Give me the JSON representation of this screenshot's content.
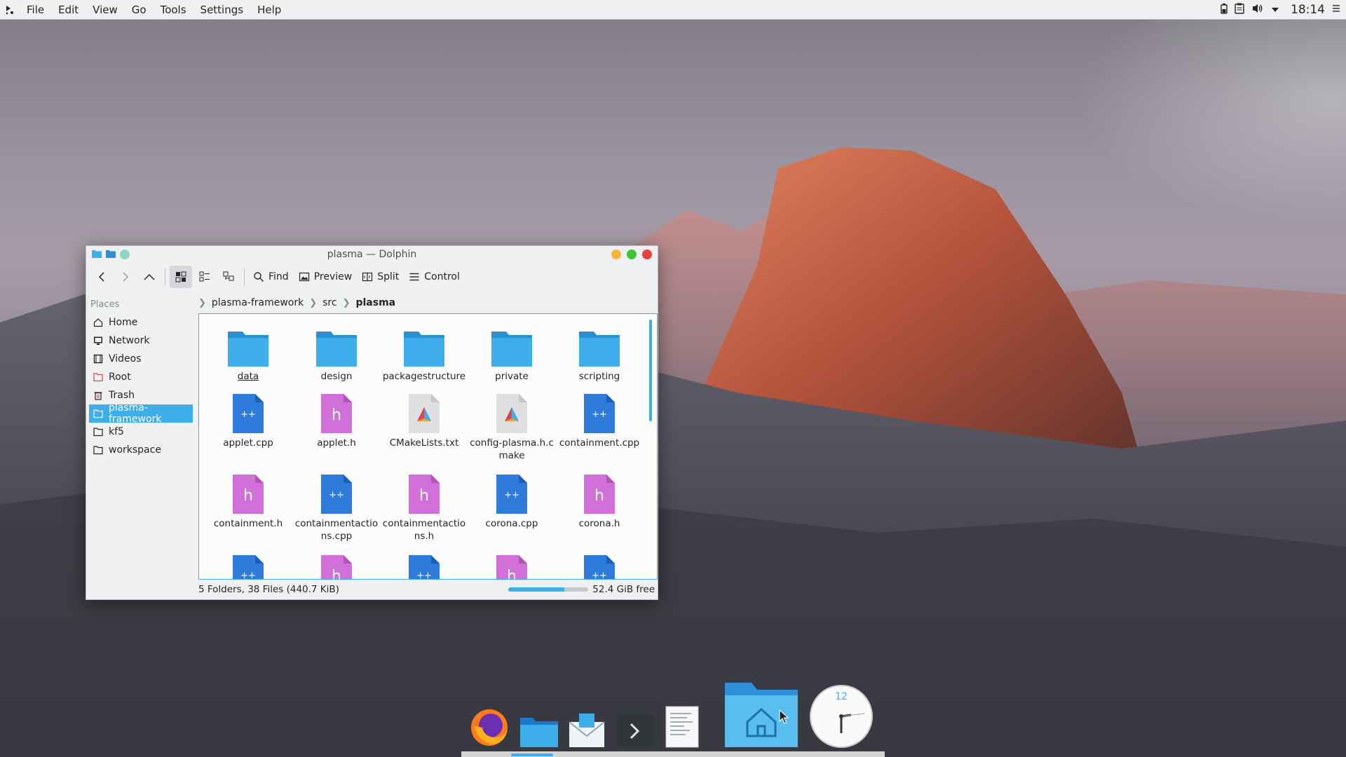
{
  "menubar": {
    "items": [
      "File",
      "Edit",
      "View",
      "Go",
      "Tools",
      "Settings",
      "Help"
    ],
    "mnemonics": [
      "F",
      "E",
      "V",
      "G",
      "T",
      "S",
      "H"
    ],
    "clock": "18:14"
  },
  "window": {
    "title": "plasma — Dolphin",
    "toolbar": {
      "find": "Find",
      "preview": "Preview",
      "split": "Split",
      "control": "Control"
    },
    "places": {
      "header": "Places",
      "items": [
        {
          "label": "Home",
          "icon": "home-icon"
        },
        {
          "label": "Network",
          "icon": "network-icon"
        },
        {
          "label": "Videos",
          "icon": "video-icon"
        },
        {
          "label": "Root",
          "icon": "root-folder-icon"
        },
        {
          "label": "Trash",
          "icon": "trash-icon"
        },
        {
          "label": "plasma-framework",
          "icon": "folder-icon",
          "selected": true
        },
        {
          "label": "kf5",
          "icon": "folder-icon"
        },
        {
          "label": "workspace",
          "icon": "folder-icon"
        }
      ]
    },
    "breadcrumb": [
      "plasma-framework",
      "src",
      "plasma"
    ],
    "files": [
      {
        "name": "data",
        "type": "folder"
      },
      {
        "name": "design",
        "type": "folder"
      },
      {
        "name": "packagestructure",
        "type": "folder"
      },
      {
        "name": "private",
        "type": "folder"
      },
      {
        "name": "scripting",
        "type": "folder"
      },
      {
        "name": "applet.cpp",
        "type": "cpp"
      },
      {
        "name": "applet.h",
        "type": "h"
      },
      {
        "name": "CMakeLists.txt",
        "type": "cmake"
      },
      {
        "name": "config-plasma.h.cmake",
        "type": "cmake"
      },
      {
        "name": "containment.cpp",
        "type": "cpp"
      },
      {
        "name": "containment.h",
        "type": "h"
      },
      {
        "name": "containmentactions.cpp",
        "type": "cpp"
      },
      {
        "name": "containmentactions.h",
        "type": "h"
      },
      {
        "name": "corona.cpp",
        "type": "cpp"
      },
      {
        "name": "corona.h",
        "type": "h"
      },
      {
        "name": "",
        "type": "cpp"
      },
      {
        "name": "",
        "type": "h"
      },
      {
        "name": "",
        "type": "cpp"
      },
      {
        "name": "",
        "type": "h"
      },
      {
        "name": "",
        "type": "cpp"
      }
    ],
    "status": {
      "summary": "5 Folders, 38 Files (440.7 KiB)",
      "free": "52.4 GiB free",
      "used_fraction": 0.7
    }
  },
  "dock": {
    "items": [
      "firefox-icon",
      "file-manager-icon",
      "mail-icon",
      "terminal-icon",
      "text-editor-icon",
      "home-folder-icon",
      "clock-widget-icon"
    ],
    "clock_number": "12"
  },
  "colors": {
    "accent": "#3daee9",
    "folder": "#3daee9",
    "cpp": "#2f7bdc",
    "h": "#d070d8"
  }
}
